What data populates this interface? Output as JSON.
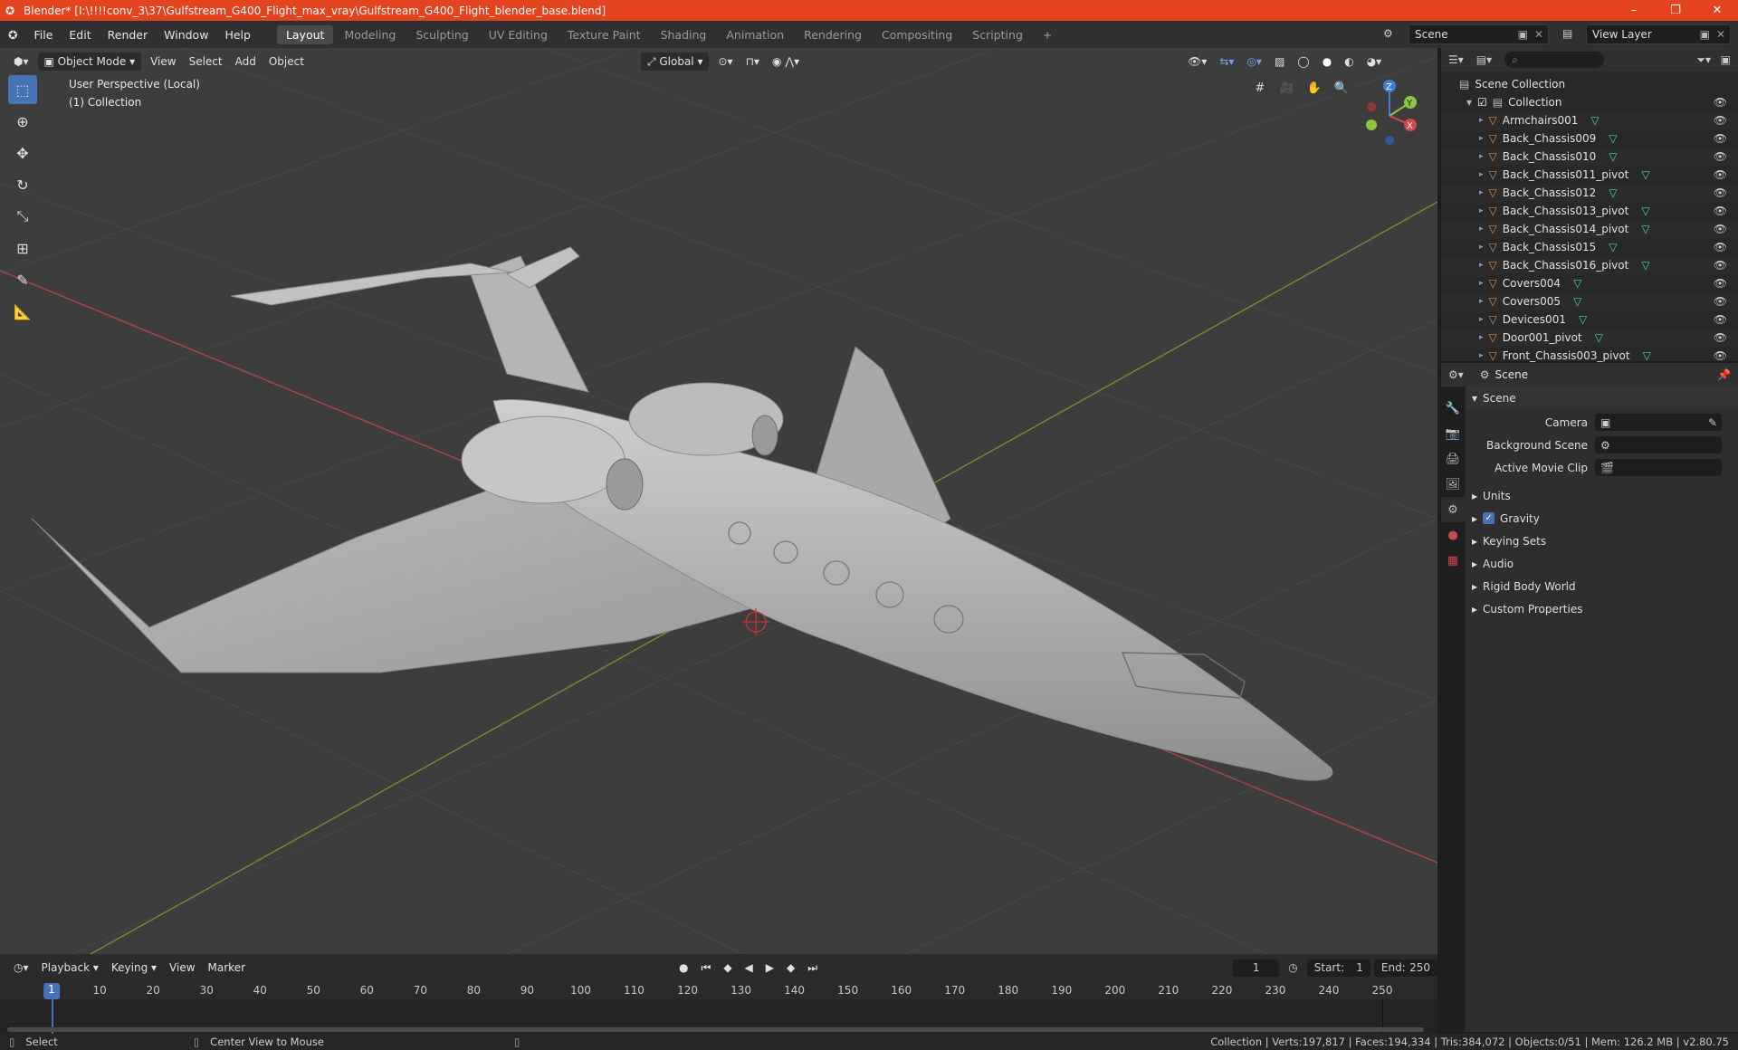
{
  "window": {
    "title": "Blender* [I:\\!!!!conv_3\\37\\Gulfstream_G400_Flight_max_vray\\Gulfstream_G400_Flight_blender_base.blend]",
    "controls": [
      "–",
      "❐",
      "✕"
    ]
  },
  "menu": {
    "items": [
      "File",
      "Edit",
      "Render",
      "Window",
      "Help"
    ],
    "workspaces": [
      "Layout",
      "Modeling",
      "Sculpting",
      "UV Editing",
      "Texture Paint",
      "Shading",
      "Animation",
      "Rendering",
      "Compositing",
      "Scripting"
    ],
    "active_workspace": "Layout",
    "add_workspace": "+",
    "scene_name": "Scene",
    "view_layer": "View Layer"
  },
  "viewport": {
    "mode": "Object Mode",
    "menus": [
      "View",
      "Select",
      "Add",
      "Object"
    ],
    "orientation": "Global",
    "info_line1": "User Perspective (Local)",
    "info_line2": "(1) Collection",
    "axis_labels": {
      "x": "X",
      "y": "Y",
      "z": "Z"
    },
    "colors": {
      "x_axis": "#d6484f",
      "y_axis": "#8cc63e",
      "z_axis": "#3b7dd8",
      "grid_bg": "#3d3d3d"
    }
  },
  "outliner": {
    "search_placeholder": "",
    "root": "Scene Collection",
    "collection": "Collection",
    "objects": [
      "Armchairs001",
      "Back_Chassis009",
      "Back_Chassis010",
      "Back_Chassis011_pivot",
      "Back_Chassis012",
      "Back_Chassis013_pivot",
      "Back_Chassis014_pivot",
      "Back_Chassis015",
      "Back_Chassis016_pivot",
      "Covers004",
      "Covers005",
      "Devices001",
      "Door001_pivot",
      "Front_Chassis003_pivot"
    ]
  },
  "properties": {
    "context": "Scene",
    "panel_title": "Scene",
    "fields": [
      {
        "label": "Camera",
        "value": ""
      },
      {
        "label": "Background Scene",
        "value": ""
      },
      {
        "label": "Active Movie Clip",
        "value": ""
      }
    ],
    "subpanels": [
      "Units",
      "Gravity",
      "Keying Sets",
      "Audio",
      "Rigid Body World",
      "Custom Properties"
    ],
    "gravity_checked": true
  },
  "timeline": {
    "menus": [
      "Playback",
      "Keying",
      "View",
      "Marker"
    ],
    "current_frame": "1",
    "start_label": "Start:",
    "start": "1",
    "end_label": "End:",
    "end": "250",
    "ruler": [
      "10",
      "20",
      "30",
      "40",
      "50",
      "60",
      "70",
      "80",
      "90",
      "100",
      "110",
      "120",
      "130",
      "140",
      "150",
      "160",
      "170",
      "180",
      "190",
      "200",
      "210",
      "220",
      "230",
      "240",
      "250"
    ],
    "ruler_current": "1"
  },
  "status": {
    "left_action": "Select",
    "middle_action": "Center View to Mouse",
    "stats": "Collection | Verts:197,817 | Faces:194,334 | Tris:384,072 | Objects:0/51 | Mem: 126.2 MB | v2.80.75"
  }
}
